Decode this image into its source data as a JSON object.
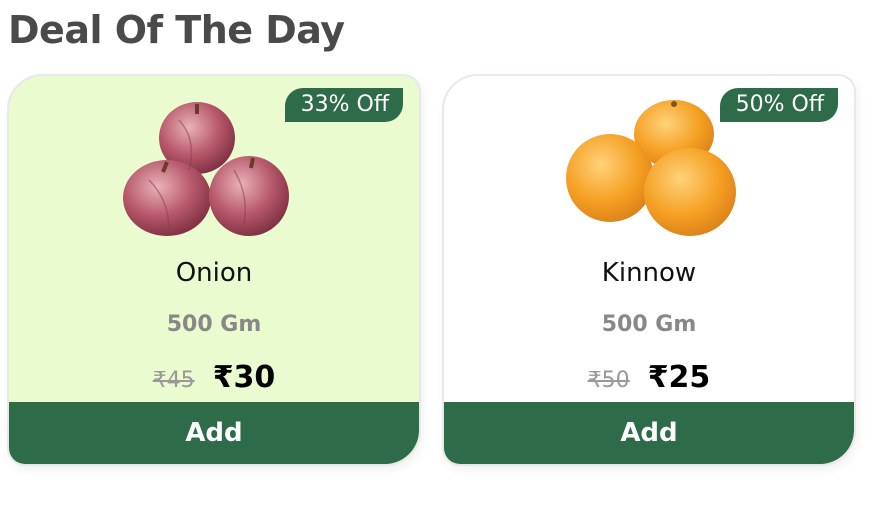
{
  "section": {
    "title": "Deal Of The Day"
  },
  "colors": {
    "accent": "#2e6b48",
    "highlight_card_bg": "#ebfbd0"
  },
  "products": [
    {
      "name": "Onion",
      "quantity": "500 Gm",
      "mrp": "₹45",
      "price": "₹30",
      "discount": "33% Off",
      "add_label": "Add",
      "image_icon": "onion-image"
    },
    {
      "name": "Kinnow",
      "quantity": "500 Gm",
      "mrp": "₹50",
      "price": "₹25",
      "discount": "50% Off",
      "add_label": "Add",
      "image_icon": "orange-image"
    }
  ]
}
